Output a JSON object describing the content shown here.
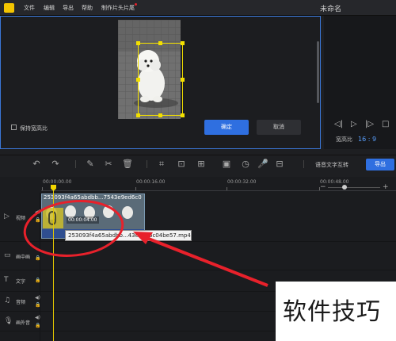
{
  "menu": {
    "items": [
      "文件",
      "编辑",
      "导出",
      "帮助",
      "制作片头片尾"
    ],
    "title": "未命名"
  },
  "crop": {
    "keep_ratio_label": "保持宽高比",
    "confirm_label": "确定",
    "cancel_label": "取消"
  },
  "preview": {
    "ratio_label": "宽高比",
    "ratio_value": "16 : 9"
  },
  "toolbar": {
    "speech_to_text": "语音文字互转",
    "export_label": "导出"
  },
  "ruler": {
    "labels": [
      "00:00:00.00",
      "00:00:16.00",
      "00:00:32.00",
      "00:00:48.00"
    ]
  },
  "tracks": [
    {
      "name": "视频",
      "icon": "video-track-icon"
    },
    {
      "name": "画中画",
      "icon": "pip-track-icon"
    },
    {
      "name": "文字",
      "icon": "text-track-icon"
    },
    {
      "name": "音频",
      "icon": "music-track-icon"
    },
    {
      "name": "画外音",
      "icon": "mic-track-icon"
    }
  ],
  "clip": {
    "name": "253093f4a65abdbb...7543e9ed6c0",
    "time": "00:00:04.00",
    "tooltip": "253093f4a65abdbb...43e9ed6c04be57.mp4"
  },
  "watermark": "软件技巧",
  "colors": {
    "accent": "#2f6fe0",
    "playhead": "#f3d600",
    "annotation": "#e8212b"
  }
}
